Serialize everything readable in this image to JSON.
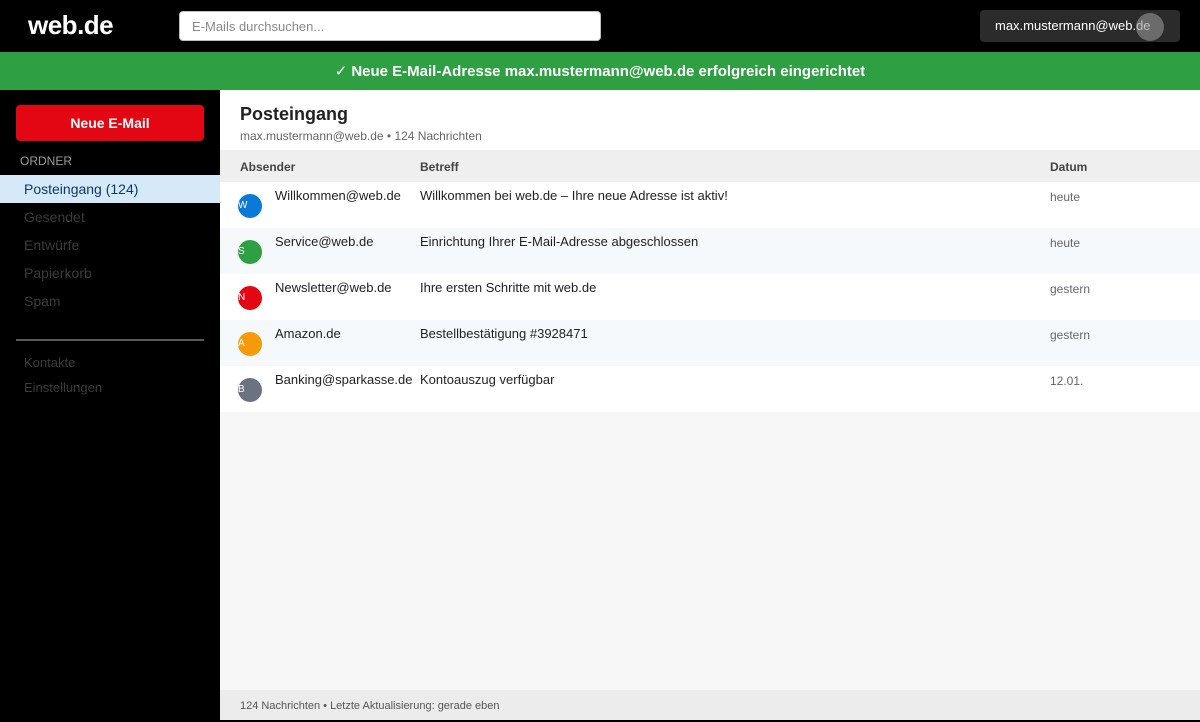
{
  "brand": {
    "logo": "web.de"
  },
  "search": {
    "placeholder": "E-Mails durchsuchen..."
  },
  "account": {
    "email": "max.mustermann@web.de"
  },
  "banner": {
    "icon": "✓",
    "text": "Neue E-Mail-Adresse max.mustermann@web.de erfolgreich eingerichtet"
  },
  "sidebar": {
    "compose_label": "Neue E-Mail",
    "folders_heading": "ORDNER",
    "folders": [
      {
        "label": "Posteingang (124)"
      },
      {
        "label": "Gesendet"
      },
      {
        "label": "Entwürfe"
      },
      {
        "label": "Papierkorb"
      },
      {
        "label": "Spam"
      }
    ],
    "links": [
      {
        "label": "Kontakte"
      },
      {
        "label": "Einstellungen"
      }
    ]
  },
  "main": {
    "title": "Posteingang",
    "subtitle": "max.mustermann@web.de • 124 Nachrichten",
    "columns": {
      "sender": "Absender",
      "subject": "Betreff",
      "date": "Datum"
    },
    "emails": [
      {
        "initial": "W",
        "sender": "Willkommen@web.de",
        "subject": "Willkommen bei web.de – Ihre neue Adresse ist aktiv!",
        "date": "heute"
      },
      {
        "initial": "S",
        "sender": "Service@web.de",
        "subject": "Einrichtung Ihrer E-Mail-Adresse abgeschlossen",
        "date": "heute"
      },
      {
        "initial": "N",
        "sender": "Newsletter@web.de",
        "subject": "Ihre ersten Schritte mit web.de",
        "date": "gestern"
      },
      {
        "initial": "A",
        "sender": "Amazon.de",
        "subject": "Bestellbestätigung #3928471",
        "date": "gestern"
      },
      {
        "initial": "B",
        "sender": "Banking@sparkasse.de",
        "subject": "Kontoauszug verfügbar",
        "date": "12.01."
      }
    ],
    "status": "124 Nachrichten • Letzte Aktualisierung: gerade eben"
  },
  "colors": {
    "banner": "#2ea043",
    "compose": "#e30613",
    "active_folder": "#d6e9f8",
    "avatars": [
      "#0a7ad6",
      "#2ea043",
      "#e30613",
      "#f59b0b",
      "#6b7280"
    ]
  }
}
